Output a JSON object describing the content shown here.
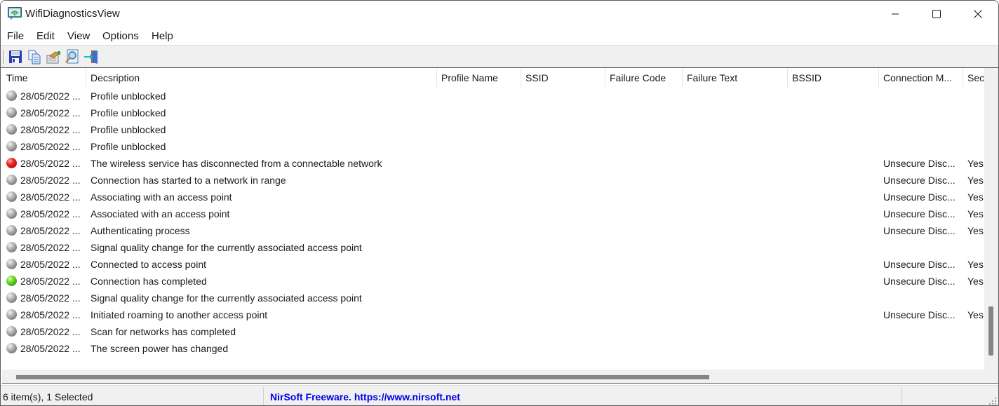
{
  "window": {
    "title": "WifiDiagnosticsView",
    "controls": {
      "minimize": "minimize",
      "maximize": "maximize",
      "close": "close"
    }
  },
  "menu": [
    "File",
    "Edit",
    "View",
    "Options",
    "Help"
  ],
  "toolbar": {
    "buttons": [
      {
        "icon": "save-icon",
        "tooltip": "Save"
      },
      {
        "icon": "copy-icon",
        "tooltip": "Copy"
      },
      {
        "icon": "properties-icon",
        "tooltip": "Properties"
      },
      {
        "icon": "find-icon",
        "tooltip": "Find"
      },
      {
        "icon": "exit-icon",
        "tooltip": "Exit"
      }
    ]
  },
  "table": {
    "columns": [
      "Time",
      "Decsription",
      "Profile Name",
      "SSID",
      "Failure Code",
      "Failure Text",
      "BSSID",
      "Connection M...",
      "Sec"
    ],
    "rows": [
      {
        "status": "gray",
        "time": "28/05/2022 ...",
        "description": "Profile unblocked",
        "profile": "",
        "ssid": "",
        "failure_code": "",
        "failure_text": "",
        "bssid": "",
        "connection_mode": "",
        "security": ""
      },
      {
        "status": "gray",
        "time": "28/05/2022 ...",
        "description": "Profile unblocked",
        "profile": "",
        "ssid": "",
        "failure_code": "",
        "failure_text": "",
        "bssid": "",
        "connection_mode": "",
        "security": ""
      },
      {
        "status": "gray",
        "time": "28/05/2022 ...",
        "description": "Profile unblocked",
        "profile": "",
        "ssid": "",
        "failure_code": "",
        "failure_text": "",
        "bssid": "",
        "connection_mode": "",
        "security": ""
      },
      {
        "status": "gray",
        "time": "28/05/2022 ...",
        "description": "Profile unblocked",
        "profile": "",
        "ssid": "",
        "failure_code": "",
        "failure_text": "",
        "bssid": "",
        "connection_mode": "",
        "security": ""
      },
      {
        "status": "red",
        "time": "28/05/2022 ...",
        "description": "The wireless service has disconnected from a connectable network",
        "profile": "",
        "ssid": "",
        "failure_code": "",
        "failure_text": "",
        "bssid": "",
        "connection_mode": "Unsecure Disc...",
        "security": "Yes"
      },
      {
        "status": "gray",
        "time": "28/05/2022 ...",
        "description": "Connection has started to a network in range",
        "profile": "",
        "ssid": "",
        "failure_code": "",
        "failure_text": "",
        "bssid": "",
        "connection_mode": "Unsecure Disc...",
        "security": "Yes"
      },
      {
        "status": "gray",
        "time": "28/05/2022 ...",
        "description": "Associating with an access point",
        "profile": "",
        "ssid": "",
        "failure_code": "",
        "failure_text": "",
        "bssid": "",
        "connection_mode": "Unsecure Disc...",
        "security": "Yes"
      },
      {
        "status": "gray",
        "time": "28/05/2022 ...",
        "description": "Associated with an access point",
        "profile": "",
        "ssid": "",
        "failure_code": "",
        "failure_text": "",
        "bssid": "",
        "connection_mode": "Unsecure Disc...",
        "security": "Yes"
      },
      {
        "status": "gray",
        "time": "28/05/2022 ...",
        "description": "Authenticating process",
        "profile": "",
        "ssid": "",
        "failure_code": "",
        "failure_text": "",
        "bssid": "",
        "connection_mode": "Unsecure Disc...",
        "security": "Yes"
      },
      {
        "status": "gray",
        "time": "28/05/2022 ...",
        "description": "Signal quality change for the currently associated access point",
        "profile": "",
        "ssid": "",
        "failure_code": "",
        "failure_text": "",
        "bssid": "",
        "connection_mode": "",
        "security": ""
      },
      {
        "status": "gray",
        "time": "28/05/2022 ...",
        "description": "Connected to access point",
        "profile": "",
        "ssid": "",
        "failure_code": "",
        "failure_text": "",
        "bssid": "",
        "connection_mode": "Unsecure Disc...",
        "security": "Yes"
      },
      {
        "status": "green",
        "time": "28/05/2022 ...",
        "description": "Connection has completed",
        "profile": "",
        "ssid": "",
        "failure_code": "",
        "failure_text": "",
        "bssid": "",
        "connection_mode": "Unsecure Disc...",
        "security": "Yes"
      },
      {
        "status": "gray",
        "time": "28/05/2022 ...",
        "description": "Signal quality change for the currently associated access point",
        "profile": "",
        "ssid": "",
        "failure_code": "",
        "failure_text": "",
        "bssid": "",
        "connection_mode": "",
        "security": ""
      },
      {
        "status": "gray",
        "time": "28/05/2022 ...",
        "description": "Initiated roaming to another access point",
        "profile": "",
        "ssid": "",
        "failure_code": "",
        "failure_text": "",
        "bssid": "",
        "connection_mode": "Unsecure Disc...",
        "security": "Yes"
      },
      {
        "status": "gray",
        "time": "28/05/2022 ...",
        "description": "Scan for networks has completed",
        "profile": "",
        "ssid": "",
        "failure_code": "",
        "failure_text": "",
        "bssid": "",
        "connection_mode": "",
        "security": ""
      },
      {
        "status": "gray",
        "time": "28/05/2022 ...",
        "description": "The screen power has changed",
        "profile": "",
        "ssid": "",
        "failure_code": "",
        "failure_text": "",
        "bssid": "",
        "connection_mode": "",
        "security": ""
      }
    ]
  },
  "statusbar": {
    "items_text": "6 item(s), 1 Selected",
    "link_text": "NirSoft Freeware. https://www.nirsoft.net"
  },
  "colors": {
    "link": "#0000ee",
    "status_gray": "#8a8a8a",
    "status_red": "#e02020",
    "status_green": "#4fc41a"
  }
}
